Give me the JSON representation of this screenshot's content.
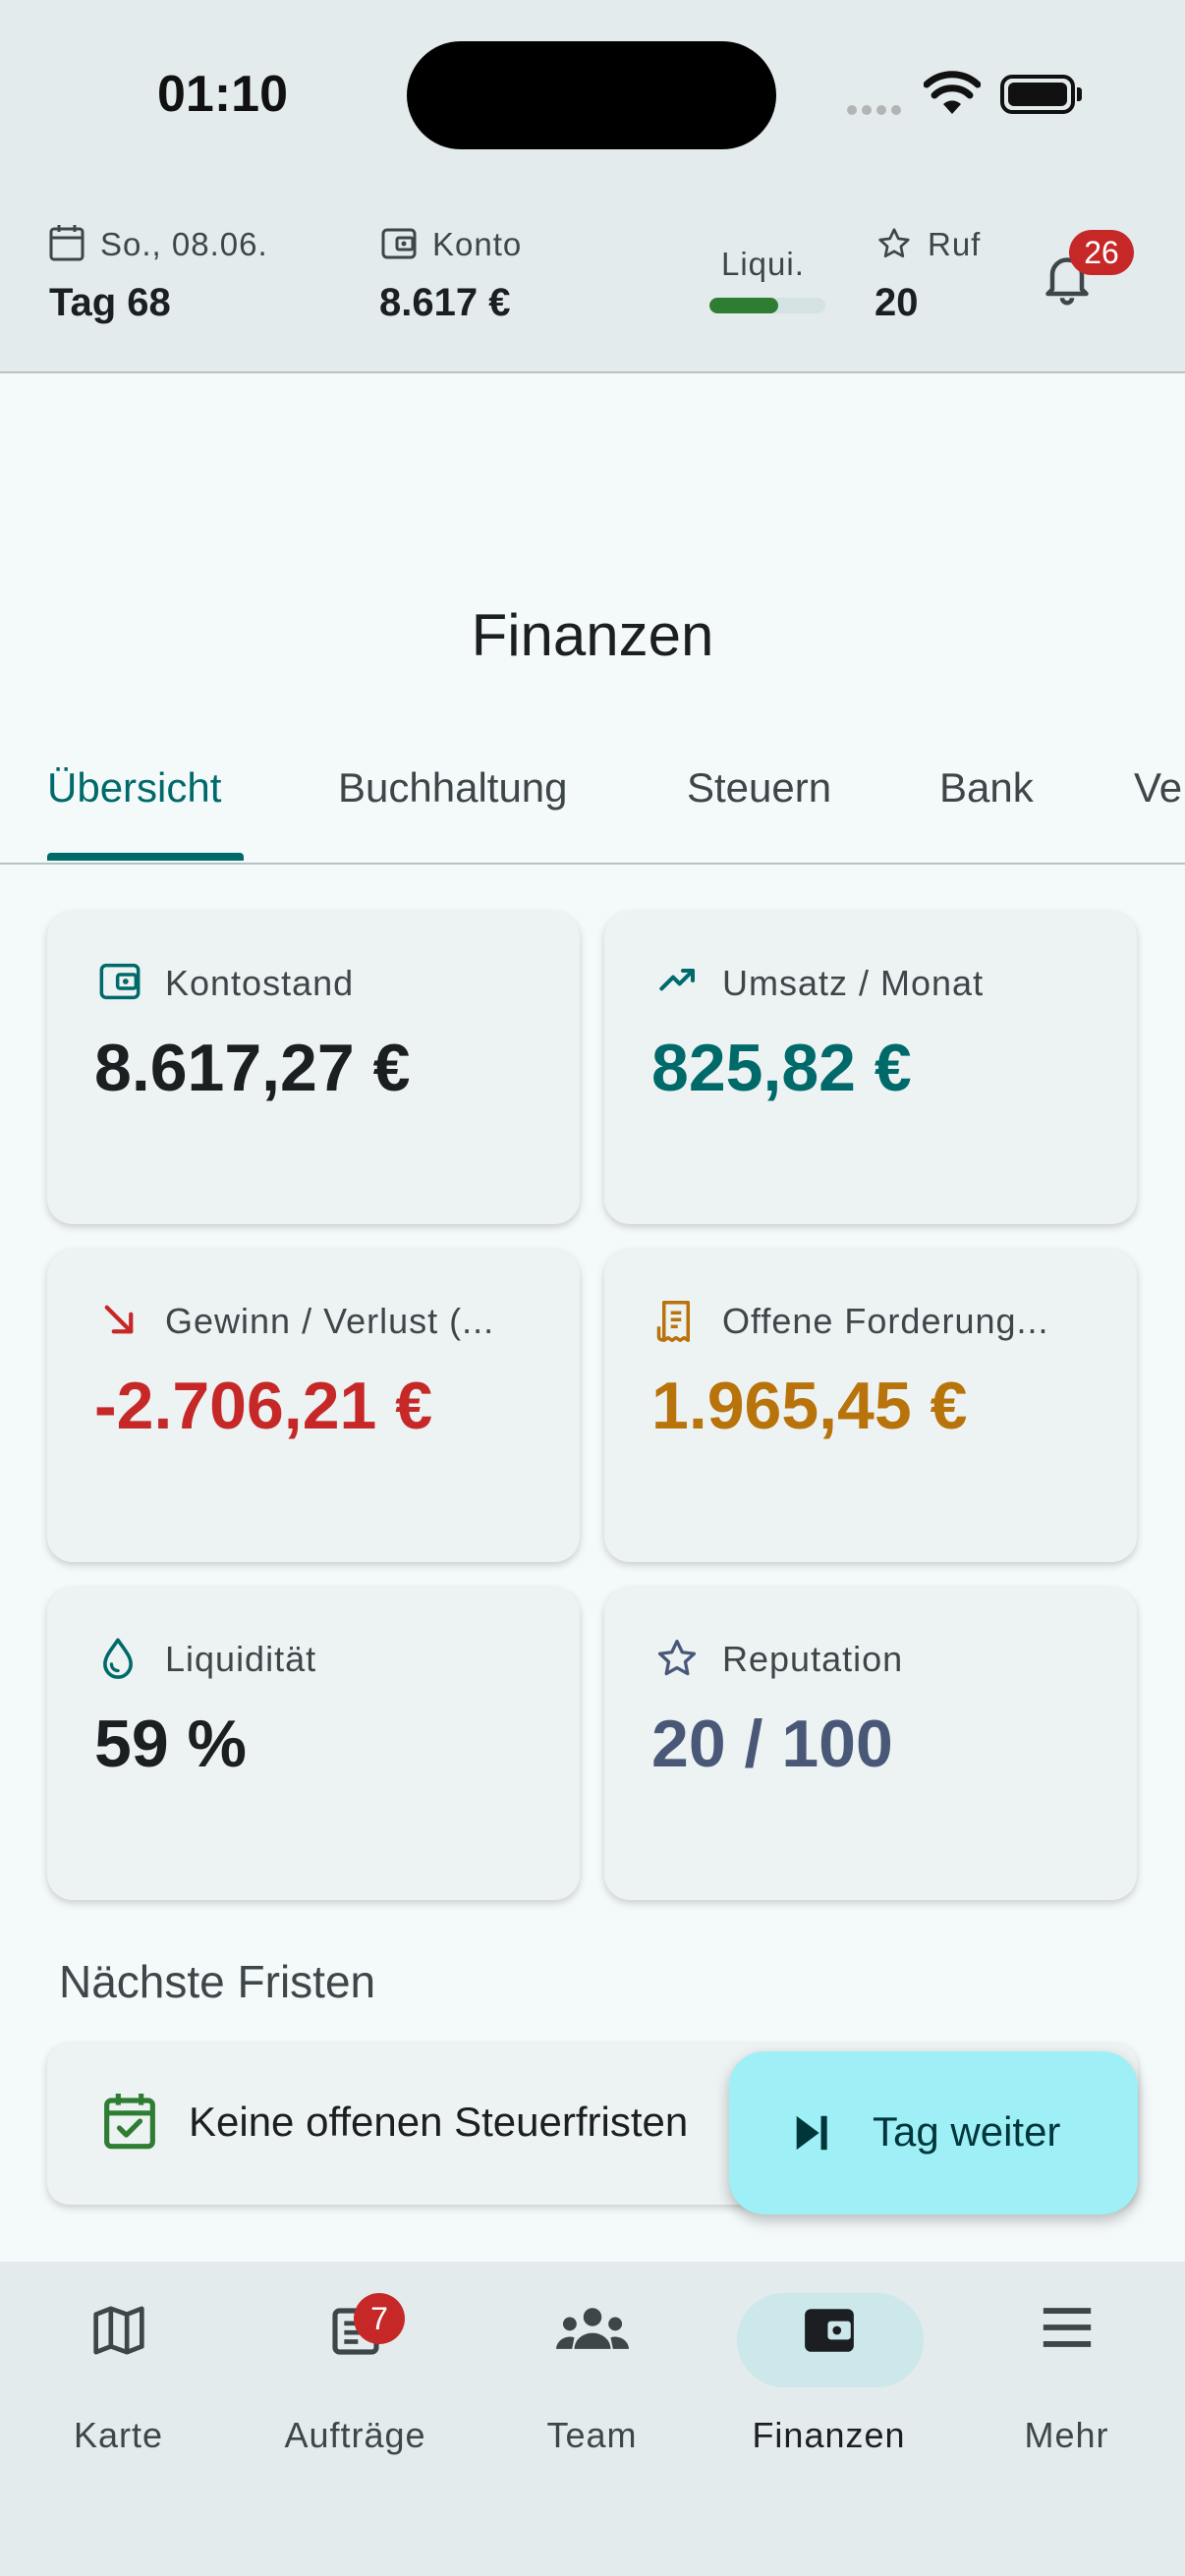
{
  "status_bar": {
    "time": "01:10"
  },
  "header": {
    "date": {
      "label": "So., 08.06.",
      "value": "Tag 68"
    },
    "account": {
      "label": "Konto",
      "value": "8.617 €"
    },
    "liquidity": {
      "label": "Liqui.",
      "level_percent": 59,
      "color": "#2e7d32"
    },
    "reputation": {
      "label": "Ruf",
      "value": "20"
    },
    "notifications": {
      "count": "26"
    }
  },
  "page": {
    "title": "Finanzen"
  },
  "tabs": [
    {
      "label": "Übersicht",
      "active": true
    },
    {
      "label": "Buchhaltung"
    },
    {
      "label": "Steuern"
    },
    {
      "label": "Bank"
    },
    {
      "label": "Ve"
    }
  ],
  "cards": [
    {
      "label": "Kontostand",
      "value": "8.617,27 €",
      "icon": "wallet-icon",
      "color": "#1b1f21"
    },
    {
      "label": "Umsatz / Monat",
      "value": "825,82 €",
      "icon": "trending-up-icon",
      "color": "#006a6a"
    },
    {
      "label": "Gewinn / Verlust (...",
      "value": "-2.706,21 €",
      "icon": "trending-down-arrow-icon",
      "color": "#c62828"
    },
    {
      "label": "Offene Forderung...",
      "value": "1.965,45 €",
      "icon": "receipt-icon",
      "color": "#b8730a"
    },
    {
      "label": "Liquidität",
      "value": "59 %",
      "icon": "water-drop-icon",
      "color": "#1b1f21"
    },
    {
      "label": "Reputation",
      "value": "20 / 100",
      "icon": "star-outline-icon",
      "color": "#4a5878"
    }
  ],
  "deadlines": {
    "title": "Nächste Fristen",
    "empty_text": "Keine offenen Steuerfristen"
  },
  "fab": {
    "label": "Tag weiter"
  },
  "bottom_nav": [
    {
      "label": "Karte",
      "icon": "map-icon"
    },
    {
      "label": "Aufträge",
      "icon": "orders-icon",
      "badge": "7"
    },
    {
      "label": "Team",
      "icon": "team-icon"
    },
    {
      "label": "Finanzen",
      "icon": "wallet-icon",
      "active": true
    },
    {
      "label": "Mehr",
      "icon": "menu-icon"
    }
  ]
}
